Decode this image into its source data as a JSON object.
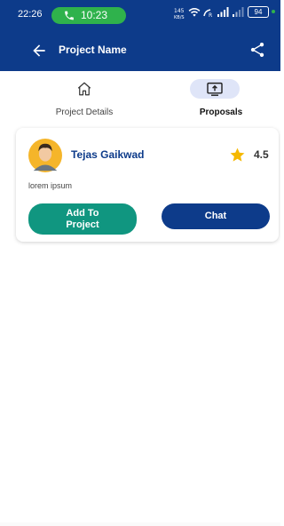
{
  "status_bar": {
    "time": "22:26",
    "call_time": "10:23",
    "battery": "94"
  },
  "app_bar": {
    "title": "Project Name",
    "back_icon": "arrow-left-icon",
    "share_icon": "share-icon"
  },
  "tabs": [
    {
      "label": "Project Details",
      "icon": "home-icon",
      "active": false
    },
    {
      "label": "Proposals",
      "icon": "upload-screen-icon",
      "active": true
    }
  ],
  "proposals": [
    {
      "name": "Tejas Gaikwad",
      "rating": "4.5",
      "description": "lorem ipsum",
      "add_button": "Add To\nProject",
      "chat_button": "Chat"
    }
  ],
  "colors": {
    "primary": "#0d3b8a",
    "accent_green": "#109680",
    "call_green": "#2fb24c",
    "star": "#f5b800",
    "tab_active_bg": "#dfe5f8"
  }
}
